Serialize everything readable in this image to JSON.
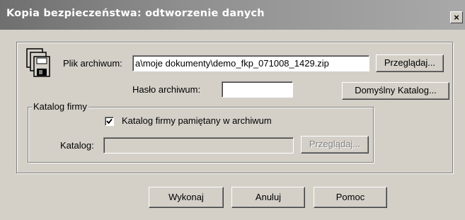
{
  "window": {
    "title": "Kopia bezpieczeństwa: odtworzenie danych",
    "close_glyph": "×"
  },
  "icon": "disks-backup-icon",
  "archive_file": {
    "label": "Plik archiwum:",
    "value": "a\\moje dokumenty\\demo_fkp_071008_1429.zip",
    "browse_label": "Przeglądaj..."
  },
  "archive_password": {
    "label": "Hasło archiwum:",
    "value": ""
  },
  "default_catalog_label": "Domyślny Katalog...",
  "company_catalog": {
    "legend": "Katalog firmy",
    "remembered_checkbox": {
      "label": "Katalog firmy pamiętany w archiwum",
      "checked": true
    },
    "catalog_label": "Katalog:",
    "catalog_value": "",
    "browse_label": "Przeglądaj..."
  },
  "actions": {
    "execute": "Wykonaj",
    "cancel": "Anuluj",
    "help": "Pomoc"
  }
}
